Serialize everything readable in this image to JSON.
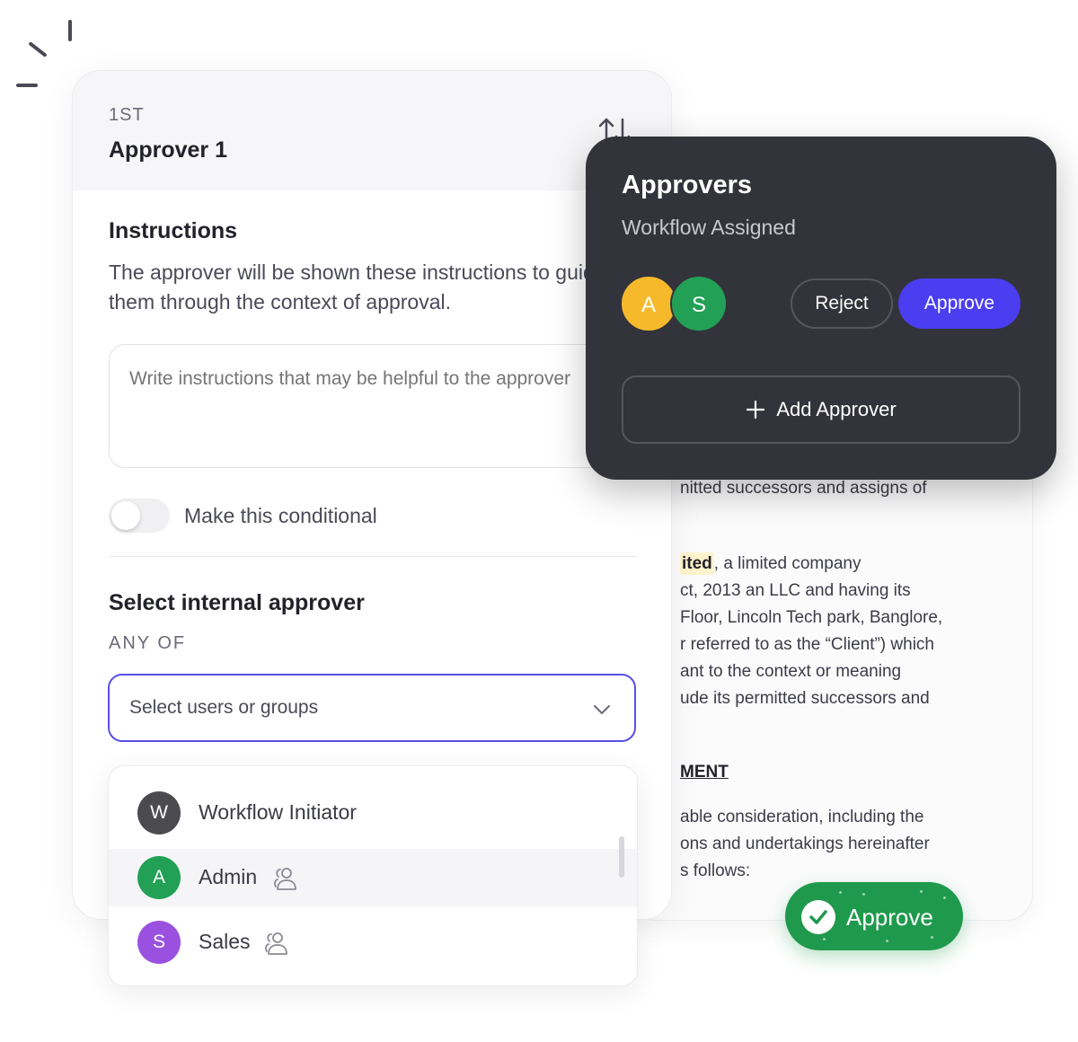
{
  "main_card": {
    "order_label": "1ST",
    "approver_title": "Approver 1",
    "instructions_title": "Instructions",
    "instructions_desc": "The approver will be shown these instructions to guide them through the context of approval.",
    "instructions_placeholder": "Write instructions that may be helpful to the approver",
    "conditional_label": "Make this conditional",
    "select_title": "Select internal approver",
    "any_of_label": "ANY OF",
    "select_placeholder": "Select users or groups"
  },
  "user_list": [
    {
      "initial": "W",
      "label": "Workflow Initiator",
      "color": "#4b4b4f",
      "group": false
    },
    {
      "initial": "A",
      "label": "Admin",
      "color": "#22a156",
      "group": true
    },
    {
      "initial": "S",
      "label": "Sales",
      "color": "#9b51e0",
      "group": true
    }
  ],
  "approvers_popover": {
    "title": "Approvers",
    "subtitle": "Workflow Assigned",
    "avatars": [
      {
        "initial": "A",
        "color": "#f6b92b"
      },
      {
        "initial": "S",
        "color": "#22a156"
      }
    ],
    "reject_label": "Reject",
    "approve_label": "Approve",
    "add_label": "Add Approver",
    "approve_color": "#4a3ef0"
  },
  "document": {
    "line1": "nitted successors and assigns of",
    "highlight": "ited",
    "line2_rest": ", a limited company",
    "line3": "ct, 2013 an LLC and having its",
    "line4": "Floor, Lincoln Tech park, Banglore,",
    "line5": "r referred to as the “Client”) which",
    "line6": "ant to the context or meaning",
    "line7": "ude its permitted successors and",
    "heading": "MENT",
    "line8": "able consideration, including the",
    "line9": "ons and undertakings hereinafter",
    "line10": "s follows:"
  },
  "green_badge": {
    "label": "Approve",
    "color": "#1f9a4d"
  }
}
